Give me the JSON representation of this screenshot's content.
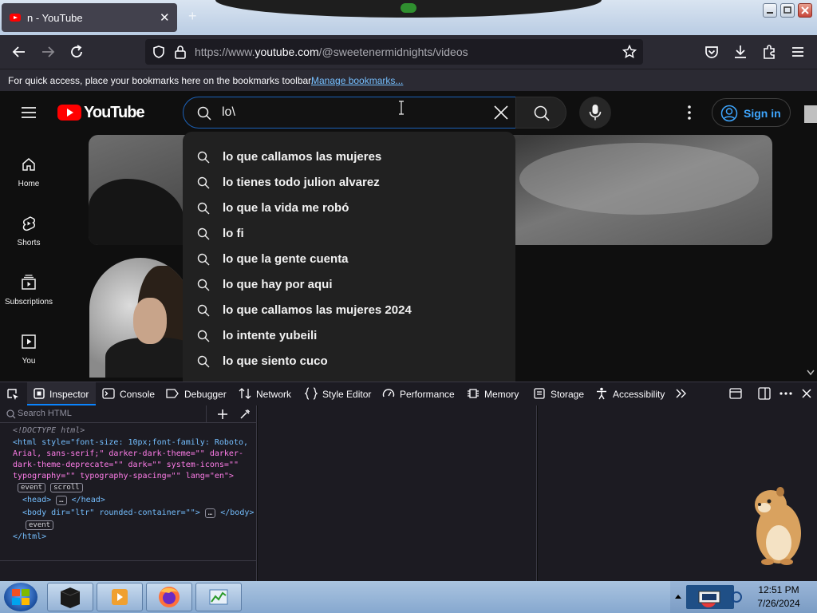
{
  "browser": {
    "tab": {
      "title": "n - YouTube",
      "close": "✕"
    },
    "new_tab": "+",
    "url": {
      "prefix": "https://www.",
      "domain": "youtube.com",
      "path": "/@sweetenermidnights/videos"
    },
    "bookmarks": {
      "message": "For quick access, place your bookmarks here on the bookmarks toolbar.",
      "manage_link": "Manage bookmarks..."
    }
  },
  "youtube": {
    "logo_text": "YouTube",
    "search_value": "lo\\",
    "sign_in": "Sign in",
    "sidebar": [
      {
        "label": "Home",
        "icon": "home-icon"
      },
      {
        "label": "Shorts",
        "icon": "shorts-icon"
      },
      {
        "label": "Subscriptions",
        "icon": "subscriptions-icon"
      },
      {
        "label": "You",
        "icon": "you-icon"
      }
    ],
    "suggestions": [
      "lo que callamos las mujeres",
      "lo tienes todo julion alvarez",
      "lo que la vida me robó",
      "lo fi",
      "lo que la gente cuenta",
      "lo que hay por aqui",
      "lo que callamos las mujeres 2024",
      "lo intente yubeili",
      "lo que siento cuco"
    ]
  },
  "devtools": {
    "tabs": [
      "Inspector",
      "Console",
      "Debugger",
      "Network",
      "Style Editor",
      "Performance",
      "Memory",
      "Storage",
      "Accessibility"
    ],
    "search_placeholder": "Search HTML",
    "html": {
      "doctype": "<!DOCTYPE html>",
      "html_open_1": "<html style=\"font-size: 10px;font-family: Roboto,",
      "html_open_2": "Arial, sans-serif;\" darker-dark-theme=\"\" darker-",
      "html_open_3": "dark-theme-deprecate=\"\" dark=\"\" system-icons=\"\"",
      "html_open_4": "typography=\"\" typography-spacing=\"\" lang=\"en\">",
      "badge_event": "event",
      "badge_scroll": "scroll",
      "head": "<head>",
      "head_close": "</head>",
      "body": "<body dir=\"ltr\" rounded-container=\"\">",
      "body_close": "</body>",
      "html_close": "</html>",
      "ellipsis": "…"
    }
  },
  "taskbar": {
    "time": "12:51 PM",
    "date": "7/26/2024"
  }
}
